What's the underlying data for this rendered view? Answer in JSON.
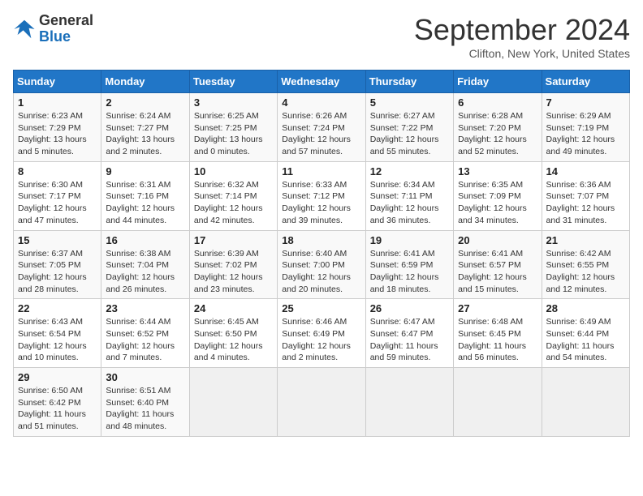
{
  "logo": {
    "line1": "General",
    "line2": "Blue"
  },
  "title": "September 2024",
  "location": "Clifton, New York, United States",
  "days_of_week": [
    "Sunday",
    "Monday",
    "Tuesday",
    "Wednesday",
    "Thursday",
    "Friday",
    "Saturday"
  ],
  "weeks": [
    [
      {
        "day": "1",
        "sunrise": "6:23 AM",
        "sunset": "7:29 PM",
        "daylight": "13 hours and 5 minutes."
      },
      {
        "day": "2",
        "sunrise": "6:24 AM",
        "sunset": "7:27 PM",
        "daylight": "13 hours and 2 minutes."
      },
      {
        "day": "3",
        "sunrise": "6:25 AM",
        "sunset": "7:25 PM",
        "daylight": "13 hours and 0 minutes."
      },
      {
        "day": "4",
        "sunrise": "6:26 AM",
        "sunset": "7:24 PM",
        "daylight": "12 hours and 57 minutes."
      },
      {
        "day": "5",
        "sunrise": "6:27 AM",
        "sunset": "7:22 PM",
        "daylight": "12 hours and 55 minutes."
      },
      {
        "day": "6",
        "sunrise": "6:28 AM",
        "sunset": "7:20 PM",
        "daylight": "12 hours and 52 minutes."
      },
      {
        "day": "7",
        "sunrise": "6:29 AM",
        "sunset": "7:19 PM",
        "daylight": "12 hours and 49 minutes."
      }
    ],
    [
      {
        "day": "8",
        "sunrise": "6:30 AM",
        "sunset": "7:17 PM",
        "daylight": "12 hours and 47 minutes."
      },
      {
        "day": "9",
        "sunrise": "6:31 AM",
        "sunset": "7:16 PM",
        "daylight": "12 hours and 44 minutes."
      },
      {
        "day": "10",
        "sunrise": "6:32 AM",
        "sunset": "7:14 PM",
        "daylight": "12 hours and 42 minutes."
      },
      {
        "day": "11",
        "sunrise": "6:33 AM",
        "sunset": "7:12 PM",
        "daylight": "12 hours and 39 minutes."
      },
      {
        "day": "12",
        "sunrise": "6:34 AM",
        "sunset": "7:11 PM",
        "daylight": "12 hours and 36 minutes."
      },
      {
        "day": "13",
        "sunrise": "6:35 AM",
        "sunset": "7:09 PM",
        "daylight": "12 hours and 34 minutes."
      },
      {
        "day": "14",
        "sunrise": "6:36 AM",
        "sunset": "7:07 PM",
        "daylight": "12 hours and 31 minutes."
      }
    ],
    [
      {
        "day": "15",
        "sunrise": "6:37 AM",
        "sunset": "7:05 PM",
        "daylight": "12 hours and 28 minutes."
      },
      {
        "day": "16",
        "sunrise": "6:38 AM",
        "sunset": "7:04 PM",
        "daylight": "12 hours and 26 minutes."
      },
      {
        "day": "17",
        "sunrise": "6:39 AM",
        "sunset": "7:02 PM",
        "daylight": "12 hours and 23 minutes."
      },
      {
        "day": "18",
        "sunrise": "6:40 AM",
        "sunset": "7:00 PM",
        "daylight": "12 hours and 20 minutes."
      },
      {
        "day": "19",
        "sunrise": "6:41 AM",
        "sunset": "6:59 PM",
        "daylight": "12 hours and 18 minutes."
      },
      {
        "day": "20",
        "sunrise": "6:41 AM",
        "sunset": "6:57 PM",
        "daylight": "12 hours and 15 minutes."
      },
      {
        "day": "21",
        "sunrise": "6:42 AM",
        "sunset": "6:55 PM",
        "daylight": "12 hours and 12 minutes."
      }
    ],
    [
      {
        "day": "22",
        "sunrise": "6:43 AM",
        "sunset": "6:54 PM",
        "daylight": "12 hours and 10 minutes."
      },
      {
        "day": "23",
        "sunrise": "6:44 AM",
        "sunset": "6:52 PM",
        "daylight": "12 hours and 7 minutes."
      },
      {
        "day": "24",
        "sunrise": "6:45 AM",
        "sunset": "6:50 PM",
        "daylight": "12 hours and 4 minutes."
      },
      {
        "day": "25",
        "sunrise": "6:46 AM",
        "sunset": "6:49 PM",
        "daylight": "12 hours and 2 minutes."
      },
      {
        "day": "26",
        "sunrise": "6:47 AM",
        "sunset": "6:47 PM",
        "daylight": "11 hours and 59 minutes."
      },
      {
        "day": "27",
        "sunrise": "6:48 AM",
        "sunset": "6:45 PM",
        "daylight": "11 hours and 56 minutes."
      },
      {
        "day": "28",
        "sunrise": "6:49 AM",
        "sunset": "6:44 PM",
        "daylight": "11 hours and 54 minutes."
      }
    ],
    [
      {
        "day": "29",
        "sunrise": "6:50 AM",
        "sunset": "6:42 PM",
        "daylight": "11 hours and 51 minutes."
      },
      {
        "day": "30",
        "sunrise": "6:51 AM",
        "sunset": "6:40 PM",
        "daylight": "11 hours and 48 minutes."
      },
      null,
      null,
      null,
      null,
      null
    ]
  ]
}
